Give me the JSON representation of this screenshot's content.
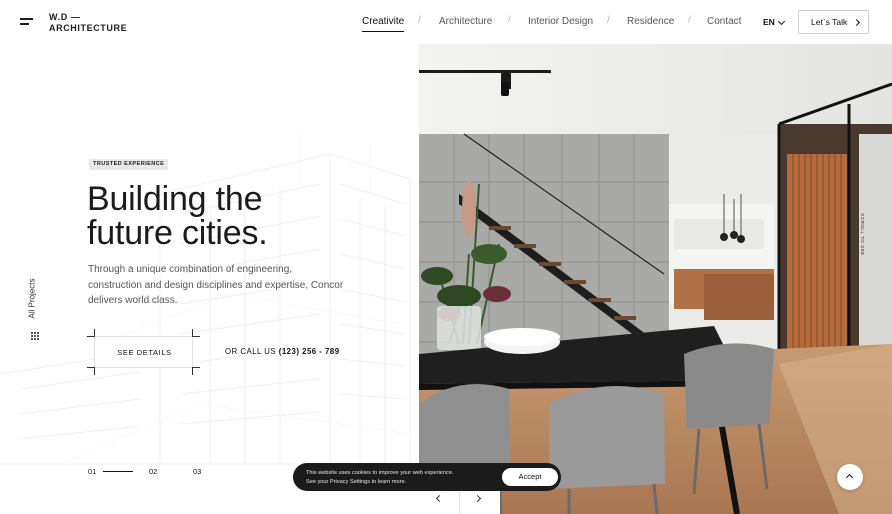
{
  "header": {
    "logo_line1": "W.D —",
    "logo_line2": "ARCHITECTURE",
    "nav": [
      {
        "label": "Creativite",
        "active": true
      },
      {
        "label": "Architecture",
        "active": false
      },
      {
        "label": "Interior Design",
        "active": false
      },
      {
        "label": "Residence",
        "active": false
      },
      {
        "label": "Contact",
        "active": false
      }
    ],
    "nav_separator": "/",
    "language": "EN",
    "cta_label": "Let`s Talk"
  },
  "sidebar": {
    "projects_label": "All Projects",
    "grid_icon": "grid-dots-icon"
  },
  "hero": {
    "badge": "TRUSTED EXPERIENCE",
    "headline_line1": "Building the",
    "headline_line2": "future cities.",
    "description": "Through a unique combination of engineering, construction and design disciplines and expertise, Concor delivers world class.",
    "details_button": "SEE DETAILS",
    "call_prefix": "OR CALL US",
    "call_number": "(123) 256 - 789"
  },
  "pager": {
    "items": [
      "01",
      "02",
      "03"
    ],
    "active_index": 0
  },
  "slider": {
    "scroll_label": "SCROLL TO SEE",
    "prev_icon": "chevron-left-icon",
    "next_icon": "chevron-right-icon"
  },
  "cookie": {
    "line1": "This website uses cookies to improve your web experience.",
    "line2": "See your Privacy Settings to learn more.",
    "accept_label": "Accept"
  },
  "colors": {
    "text": "#1d1d1f",
    "muted": "#555555",
    "badge_bg": "#e8e8e8",
    "cookie_bg": "#1b1b1b",
    "wood": "#a9643a"
  }
}
